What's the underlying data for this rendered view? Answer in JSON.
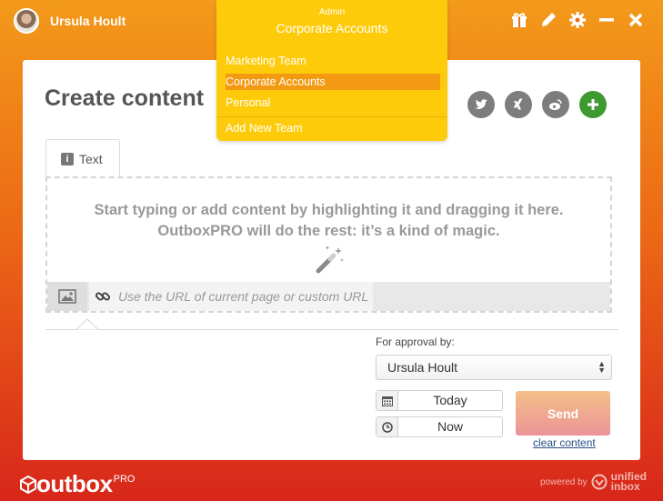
{
  "user": {
    "name": "Ursula Hoult"
  },
  "header_icons": [
    "gift-icon",
    "pencil-icon",
    "gear-icon",
    "minimize-icon",
    "close-icon"
  ],
  "page": {
    "title": "Create content"
  },
  "social_icons": [
    "twitter-icon",
    "xing-icon",
    "weibo-icon",
    "add-icon"
  ],
  "team_menu": {
    "role": "Admin",
    "current": "Corporate Accounts",
    "items": [
      "Marketing Team",
      "Corporate Accounts",
      "Personal"
    ],
    "active_index": 1,
    "add_label": "Add New Team"
  },
  "tabs": [
    {
      "label": "Text",
      "icon": "info-icon"
    }
  ],
  "dropzone": {
    "line1": "Start typing or add content by highlighting it and dragging it here.",
    "line2": "OutboxPRO will do the rest: it’s a kind of magic."
  },
  "url_input": {
    "placeholder": "Use the URL of current page or custom URL"
  },
  "approval": {
    "label": "For approval by:",
    "selected": "Ursula Hoult"
  },
  "schedule": {
    "date": "Today",
    "time": "Now"
  },
  "actions": {
    "send": "Send",
    "clear": "clear content"
  },
  "footer": {
    "logo": "outbox",
    "logo_suffix": "PRO",
    "powered_by": "powered by",
    "brand_line1": "unified",
    "brand_line2": "inbox"
  },
  "colors": {
    "menu_bg": "#fecb0a",
    "menu_active": "#f39a12",
    "add_button": "#3e9a30",
    "link": "#2a4f86"
  }
}
